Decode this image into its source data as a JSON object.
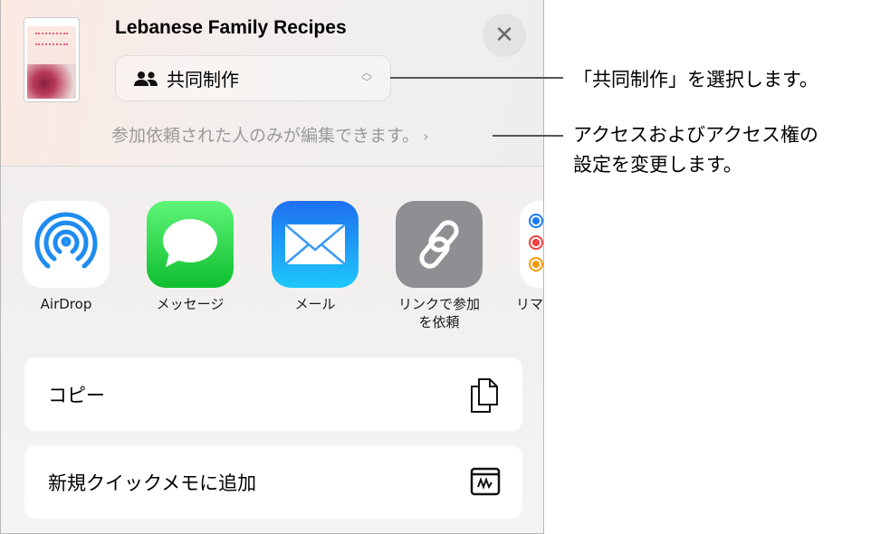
{
  "header": {
    "document_title": "Lebanese Family Recipes",
    "collab_mode": "共同制作",
    "access_summary": "参加依頼された人のみが編集できます。",
    "close_icon": "close-icon"
  },
  "apps": [
    {
      "label": "AirDrop",
      "icon": "airdrop-icon"
    },
    {
      "label": "メッセージ",
      "icon": "messages-icon"
    },
    {
      "label": "メール",
      "icon": "mail-icon"
    },
    {
      "label": "リンクで参加\nを依頼",
      "line1": "リンクで参加",
      "line2": "を依頼",
      "icon": "link-icon"
    },
    {
      "label": "リマ",
      "icon": "reminders-icon"
    }
  ],
  "actions": [
    {
      "label": "コピー",
      "icon": "copy-icon"
    },
    {
      "label": "新規クイックメモに追加",
      "icon": "quick-note-icon"
    }
  ],
  "callouts": [
    {
      "text": "「共同制作」を選択します。"
    },
    {
      "line1": "アクセスおよびアクセス権の",
      "line2": "設定を変更します。"
    }
  ]
}
